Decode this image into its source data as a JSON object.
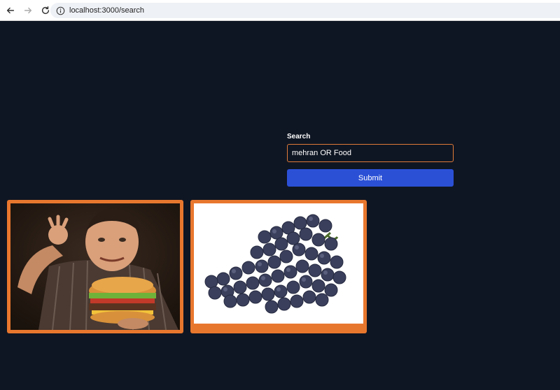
{
  "browser": {
    "url": "localhost:3000/search"
  },
  "search": {
    "label": "Search",
    "value": "mehran OR Food",
    "submit_label": "Submit"
  },
  "results": [
    {
      "image": "man-eating-burger"
    },
    {
      "image": "bunch-of-grapes"
    }
  ],
  "colors": {
    "background": "#0f1623",
    "accent_orange": "#e8772e",
    "submit_blue": "#2b50d6"
  }
}
